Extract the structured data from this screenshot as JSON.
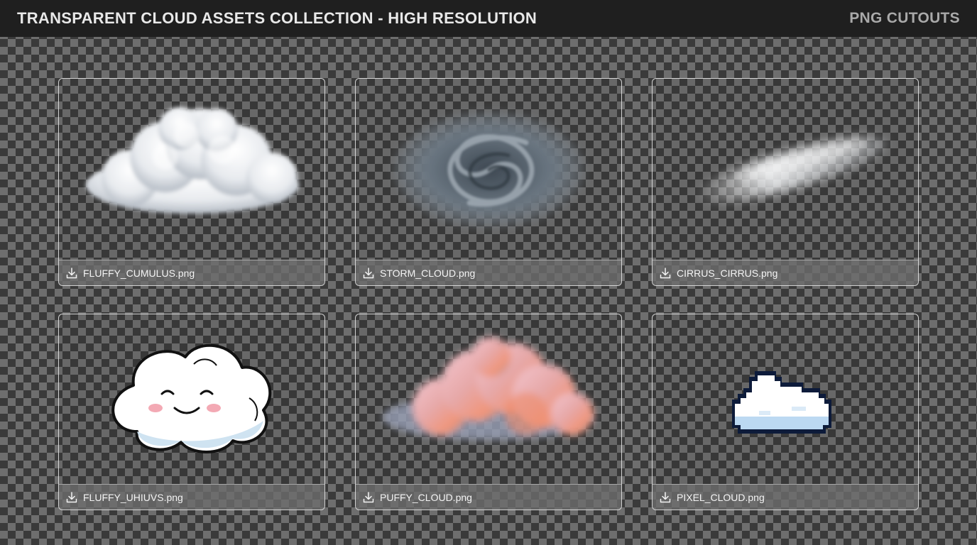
{
  "header": {
    "title": "TRANSPARENT CLOUD ASSETS COLLECTION - HIGH RESOLUTION",
    "tag": "PNG CUTOUTS"
  },
  "assets": [
    {
      "filename": "FLUFFY_CUMULUS.png",
      "icon": "download-icon"
    },
    {
      "filename": "STORM_CLOUD.png",
      "icon": "download-icon"
    },
    {
      "filename": "CIRRUS_CIRRUS.png",
      "icon": "download-icon"
    },
    {
      "filename": "FLUFFY_UHIUVS.png",
      "icon": "download-icon"
    },
    {
      "filename": "PUFFY_CLOUD.png",
      "icon": "download-icon"
    },
    {
      "filename": "PIXEL_CLOUD.png",
      "icon": "download-icon"
    }
  ],
  "colors": {
    "topbar": "#1f1f1f",
    "checker_dark": "#3a3a3a",
    "checker_light": "#6e6e6e",
    "footer": "#6e6e6e"
  }
}
